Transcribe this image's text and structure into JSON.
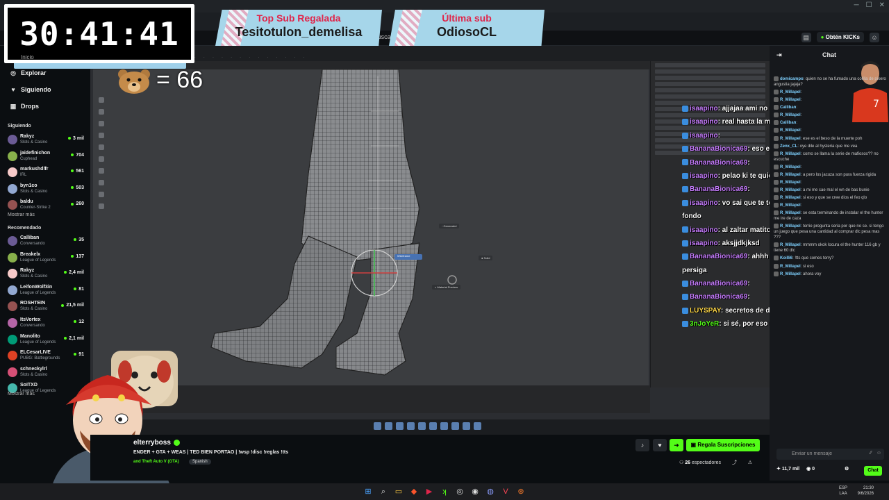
{
  "timer": {
    "value": "30:41:41"
  },
  "bear_counter": {
    "value": "= 66"
  },
  "banners": [
    {
      "title": "Top Sub Regalada",
      "name": "Tesitotulon_demelisa"
    },
    {
      "title": "Última sub",
      "name": "OdiosoCL"
    }
  ],
  "header": {
    "search_label": "Buscar",
    "kicks_label": "Obtén KICKs"
  },
  "sidebar": {
    "home": "Inicio",
    "nav": [
      {
        "label": "Explorar",
        "icon": "compass-icon"
      },
      {
        "label": "Siguiendo",
        "icon": "heart-icon"
      },
      {
        "label": "Drops",
        "icon": "gift-icon"
      }
    ],
    "following_title": "Siguiendo",
    "following": [
      {
        "name": "Rakyz",
        "game": "Slots & Casino",
        "viewers": "3 mil"
      },
      {
        "name": "jaidefinichon",
        "game": "Cuphead",
        "viewers": "704"
      },
      {
        "name": "markushdlfr",
        "game": "IRL",
        "viewers": "561"
      },
      {
        "name": "byn1co",
        "game": "Slots & Casino",
        "viewers": "503"
      },
      {
        "name": "baldu",
        "game": "Counter-Strike 2",
        "viewers": "260"
      }
    ],
    "more_label": "Mostrar más",
    "recommended_title": "Recomendado",
    "recommended": [
      {
        "name": "Calliban",
        "game": "Conversando",
        "viewers": "35"
      },
      {
        "name": "Breakelx",
        "game": "League of Legends",
        "viewers": "137"
      },
      {
        "name": "Rakyz",
        "game": "Slots & Casino",
        "viewers": "2,4 mil"
      },
      {
        "name": "LeifonWolf3in",
        "game": "League of Legends",
        "viewers": "81"
      },
      {
        "name": "ROSHTEIN",
        "game": "Slots & Casino",
        "viewers": "21,5 mil"
      },
      {
        "name": "ItsVortex",
        "game": "Conversando",
        "viewers": "12"
      },
      {
        "name": "Manolito",
        "game": "League of Legends",
        "viewers": "2,1 mil"
      },
      {
        "name": "ELCesarLIVE",
        "game": "PUBG: Battlegrounds",
        "viewers": "91"
      },
      {
        "name": "schneckylrl",
        "game": "Slots & Casino",
        "viewers": ""
      },
      {
        "name": "SoITXD",
        "game": "League of Legends",
        "viewers": ""
      }
    ],
    "more_label_2": "Mostrar más"
  },
  "stream_info": {
    "streamer": "elterryboss",
    "title": "ENDER + GTA + WEAS | TED BIEN PORTAO | !wsp !disc !reglas !tts",
    "category": "and Theft Auto V (GTA)",
    "tag": "Spanish",
    "gift_label": "Regala Suscripciones",
    "viewers_count": "26",
    "viewers_label": "espectadores"
  },
  "overlay_chat": [
    {
      "user": "isaapino",
      "color": "#c77dff",
      "text": ": ajjajaa ami no me vienen con weas"
    },
    {
      "user": "isaapino",
      "color": "#c77dff",
      "text": ": real hasta la muerte siempre"
    },
    {
      "user": "isaapino",
      "color": "#c77dff",
      "text": ":"
    },
    {
      "user": "BananaBionica69",
      "color": "#c77dff",
      "text": ": eso eso wawa niai con los giles"
    },
    {
      "user": "BananaBionica69",
      "color": "#c77dff",
      "text": ":"
    },
    {
      "user": "isaapino",
      "color": "#c77dff",
      "text": ": pelao ki te quiero pero lo mas de lejos posible"
    },
    {
      "user": "BananaBionica69",
      "color": "#c77dff",
      "text": ":"
    },
    {
      "user": "isaapino",
      "color": "#c77dff",
      "text": ": vo sai que te tengo cariño pero bien en el"
    },
    {
      "user": "",
      "color": "#ffffff",
      "text": "fondo"
    },
    {
      "user": "isaapino",
      "color": "#c77dff",
      "text": ": al zaltar matito"
    },
    {
      "user": "isaapino",
      "color": "#c77dff",
      "text": ": aksjjdkjksd"
    },
    {
      "user": "BananaBionica69",
      "color": "#c77dff",
      "text": ": ahhh toy hablando con la isa padre no se"
    },
    {
      "user": "",
      "color": "#ffffff",
      "text": "persiga"
    },
    {
      "user": "BananaBionica69",
      "color": "#c77dff",
      "text": ":"
    },
    {
      "user": "BananaBionica69",
      "color": "#c77dff",
      "text": ":"
    },
    {
      "user": "LUYSPAY",
      "color": "#ffd84a",
      "text": ": secretos de dos"
    },
    {
      "user": "3nJoYeR",
      "color": "#53fc18",
      "text": ": si sé, por eso      no te voy a pescar."
    }
  ],
  "chat": {
    "title": "Chat",
    "messages": [
      {
        "user": "domicampo",
        "text": ": quien no se ha fumado una colilla de pixero angustia jajaja?"
      },
      {
        "user": "R_Millapel",
        "text": ":"
      },
      {
        "user": "R_Millapel",
        "text": ":"
      },
      {
        "user": "Calliban",
        "text": ":"
      },
      {
        "user": "R_Millapel",
        "text": ":"
      },
      {
        "user": "Calliban",
        "text": ":"
      },
      {
        "user": "R_Millapel",
        "text": ":"
      },
      {
        "user": "R_Millapel",
        "text": ": ese es el beso de la muerte poh"
      },
      {
        "user": "Zenx_CL",
        "text": ": oye dile al hysteria que me vea"
      },
      {
        "user": "R_Millapel",
        "text": ": como se llama la serie de mafiosos?? no escuche"
      },
      {
        "user": "R_Millapel",
        "text": ":"
      },
      {
        "user": "R_Millapel",
        "text": ": a pero los jacuza son pura fuerza rigida"
      },
      {
        "user": "R_Millapel",
        "text": ":"
      },
      {
        "user": "R_Millapel",
        "text": ": a mi me cae mal el wn de bas bunie"
      },
      {
        "user": "R_Millapel",
        "text": ": si eso y que se cree dios el feo qlo"
      },
      {
        "user": "R_Millapel",
        "text": ":"
      },
      {
        "user": "R_Millapel",
        "text": ": se esta terminando de instalar el the hunter me ire de caza"
      },
      {
        "user": "R_Millapel",
        "text": ": terrie pregunta seria por que no se. si tengo un juego que pesa una cantidad al comprar dlc pesa mas ???"
      },
      {
        "user": "R_Millapel",
        "text": ": mmmm okok locura el the hunter 116 gb y tiene 60 dlc"
      },
      {
        "user": "Koilli6",
        "text": ": !tts que comes terry?"
      },
      {
        "user": "R_Millapel",
        "text": ": si eso"
      },
      {
        "user": "R_Millapel",
        "text": ": ahora voy"
      }
    ],
    "input_placeholder": "Enviar un mensaje",
    "kicks_balance": "11,7 mil",
    "points": "0",
    "send_label": "Chat"
  },
  "taskbar": {
    "lang_top": "ESP",
    "lang_bottom": "LAA",
    "time": "21:30",
    "date": "9/6/2026"
  },
  "colors": {
    "kick_green": "#53fc18",
    "banner_blue": "#a6d6ea",
    "banner_red": "#e0254a"
  }
}
